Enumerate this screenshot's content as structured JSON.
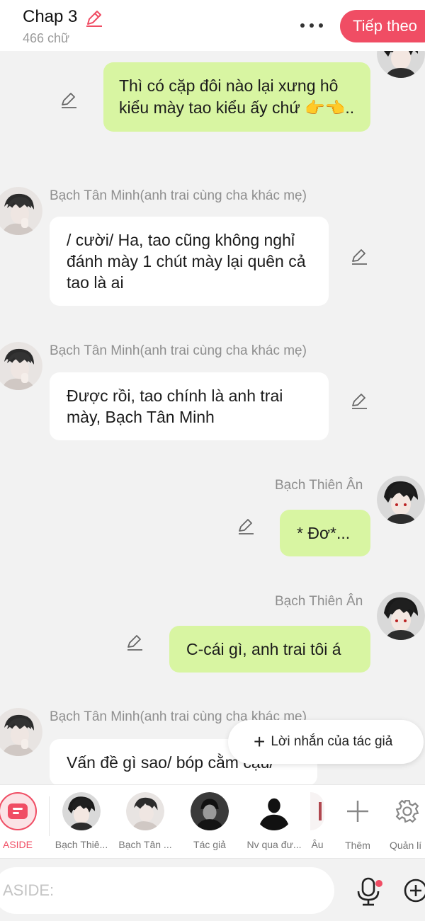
{
  "header": {
    "chapter_title": "Chap 3",
    "word_count": "466 chữ",
    "next_label": "Tiếp theo"
  },
  "messages": [
    {
      "side": "right",
      "style": "green",
      "name": "",
      "text": "Thì có cặp đôi nào lại xưng hô kiểu mày tao kiểu ấy chứ 👉👈.."
    },
    {
      "side": "left",
      "style": "white",
      "name": "Bạch Tân Minh(anh trai cùng cha khác mẹ)",
      "text": "/ cười/ Ha, tao cũng không nghỉ đánh mày 1 chút mày lại quên cả tao là ai"
    },
    {
      "side": "left",
      "style": "white",
      "name": "Bạch Tân Minh(anh trai cùng cha khác mẹ)",
      "text": "Được rồi, tao chính là anh trai mày, Bạch Tân Minh"
    },
    {
      "side": "right",
      "style": "green",
      "name": "Bạch Thiên Ân",
      "text": "* Đơ*..."
    },
    {
      "side": "right",
      "style": "green",
      "name": "Bạch Thiên Ân",
      "text": "C-cái gì, anh trai tôi á"
    },
    {
      "side": "left",
      "style": "white",
      "name": "Bạch Tân Minh(anh trai cùng cha khác mẹ)",
      "text": "Vấn đề gì sao/ bóp cằm cậu/"
    }
  ],
  "author_note": {
    "label": "Lời nhắn của tác giả"
  },
  "characters": [
    {
      "label": "ASIDE",
      "icon": "aside-icon",
      "active": true
    },
    {
      "label": "Bạch Thiê...",
      "icon": "avatar-bach-thien-an"
    },
    {
      "label": "Bạch Tân ...",
      "icon": "avatar-bach-tan-minh"
    },
    {
      "label": "Tác giả",
      "icon": "avatar-author"
    },
    {
      "label": "Nv qua đư...",
      "icon": "avatar-silhouette"
    },
    {
      "label": "Âu",
      "icon": "avatar-partial"
    },
    {
      "label": "Thêm",
      "icon": "plus-icon"
    },
    {
      "label": "Quản lí",
      "icon": "gear-icon"
    }
  ],
  "input": {
    "placeholder": "ASIDE:"
  },
  "colors": {
    "accent": "#f04d64",
    "bubble_green": "#d8f5a2",
    "bubble_white": "#ffffff",
    "background": "#f2f2f2"
  }
}
